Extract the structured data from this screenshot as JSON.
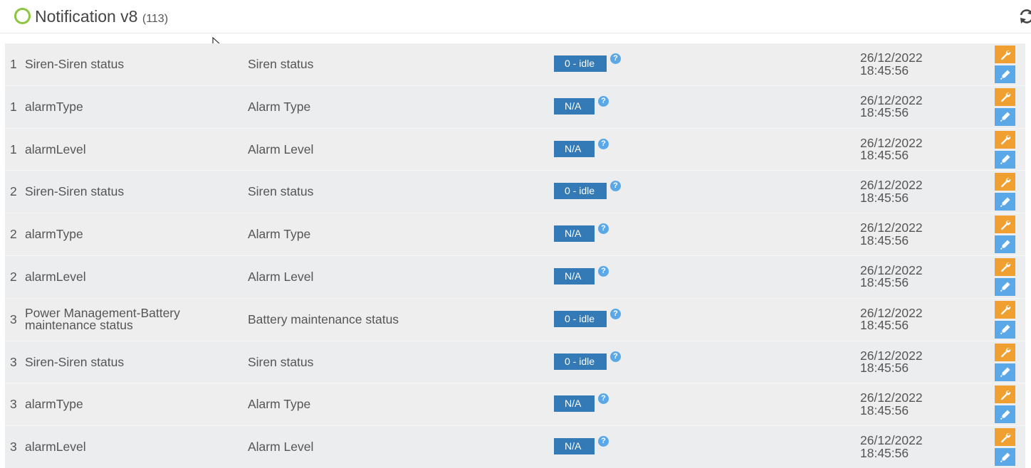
{
  "header": {
    "title": "Notification v8",
    "count": "(113)",
    "status_color": "#8cc63f"
  },
  "colors": {
    "badge": "#337ab7",
    "edit_button": "#f0a030",
    "test_button": "#5aa8e8",
    "help_icon": "#5ba8e8"
  },
  "rows": [
    {
      "instance": "1",
      "name": "Siren-Siren status",
      "label": "Siren status",
      "value": "0 - idle",
      "date": "26/12/2022",
      "time": "18:45:56"
    },
    {
      "instance": "1",
      "name": "alarmType",
      "label": "Alarm Type",
      "value": "N/A",
      "date": "26/12/2022",
      "time": "18:45:56"
    },
    {
      "instance": "1",
      "name": "alarmLevel",
      "label": "Alarm Level",
      "value": "N/A",
      "date": "26/12/2022",
      "time": "18:45:56"
    },
    {
      "instance": "2",
      "name": "Siren-Siren status",
      "label": "Siren status",
      "value": "0 - idle",
      "date": "26/12/2022",
      "time": "18:45:56"
    },
    {
      "instance": "2",
      "name": "alarmType",
      "label": "Alarm Type",
      "value": "N/A",
      "date": "26/12/2022",
      "time": "18:45:56"
    },
    {
      "instance": "2",
      "name": "alarmLevel",
      "label": "Alarm Level",
      "value": "N/A",
      "date": "26/12/2022",
      "time": "18:45:56"
    },
    {
      "instance": "3",
      "name": "Power Management-Battery maintenance status",
      "label": "Battery maintenance status",
      "value": "0 - idle",
      "date": "26/12/2022",
      "time": "18:45:56"
    },
    {
      "instance": "3",
      "name": "Siren-Siren status",
      "label": "Siren status",
      "value": "0 - idle",
      "date": "26/12/2022",
      "time": "18:45:56"
    },
    {
      "instance": "3",
      "name": "alarmType",
      "label": "Alarm Type",
      "value": "N/A",
      "date": "26/12/2022",
      "time": "18:45:56"
    },
    {
      "instance": "3",
      "name": "alarmLevel",
      "label": "Alarm Level",
      "value": "N/A",
      "date": "26/12/2022",
      "time": "18:45:56"
    }
  ]
}
